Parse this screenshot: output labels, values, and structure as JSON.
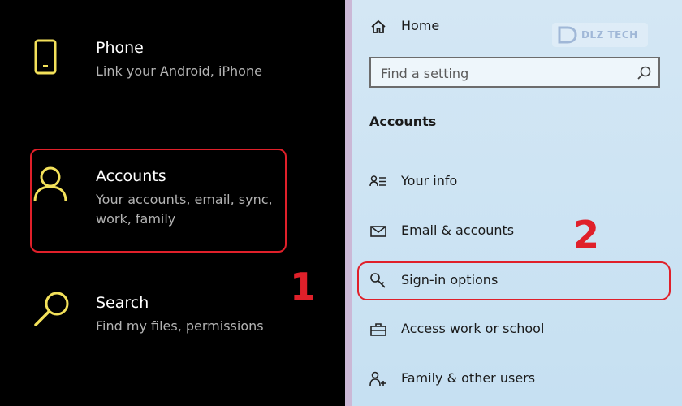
{
  "left_panel": {
    "tiles": [
      {
        "title": "Phone",
        "description": "Link your Android, iPhone"
      },
      {
        "title": "Accounts",
        "description": "Your accounts, email, sync, work, family"
      },
      {
        "title": "Search",
        "description": "Find my files, permissions"
      }
    ],
    "step_label": "1"
  },
  "right_panel": {
    "home_label": "Home",
    "search": {
      "placeholder": "Find a setting"
    },
    "section_title": "Accounts",
    "items": [
      {
        "label": "Your info",
        "icon": "person-card-icon"
      },
      {
        "label": "Email & accounts",
        "icon": "envelope-icon"
      },
      {
        "label": "Sign-in options",
        "icon": "key-icon"
      },
      {
        "label": "Access work or school",
        "icon": "briefcase-icon"
      },
      {
        "label": "Family & other users",
        "icon": "person-add-icon"
      }
    ],
    "step_label": "2",
    "watermark_text": "DLZ TECH"
  },
  "colors": {
    "accent_yellow": "#f3e15a",
    "highlight_red": "#e0202a",
    "dark_bg": "#000000",
    "settings_bg": "#c6e0f2"
  }
}
